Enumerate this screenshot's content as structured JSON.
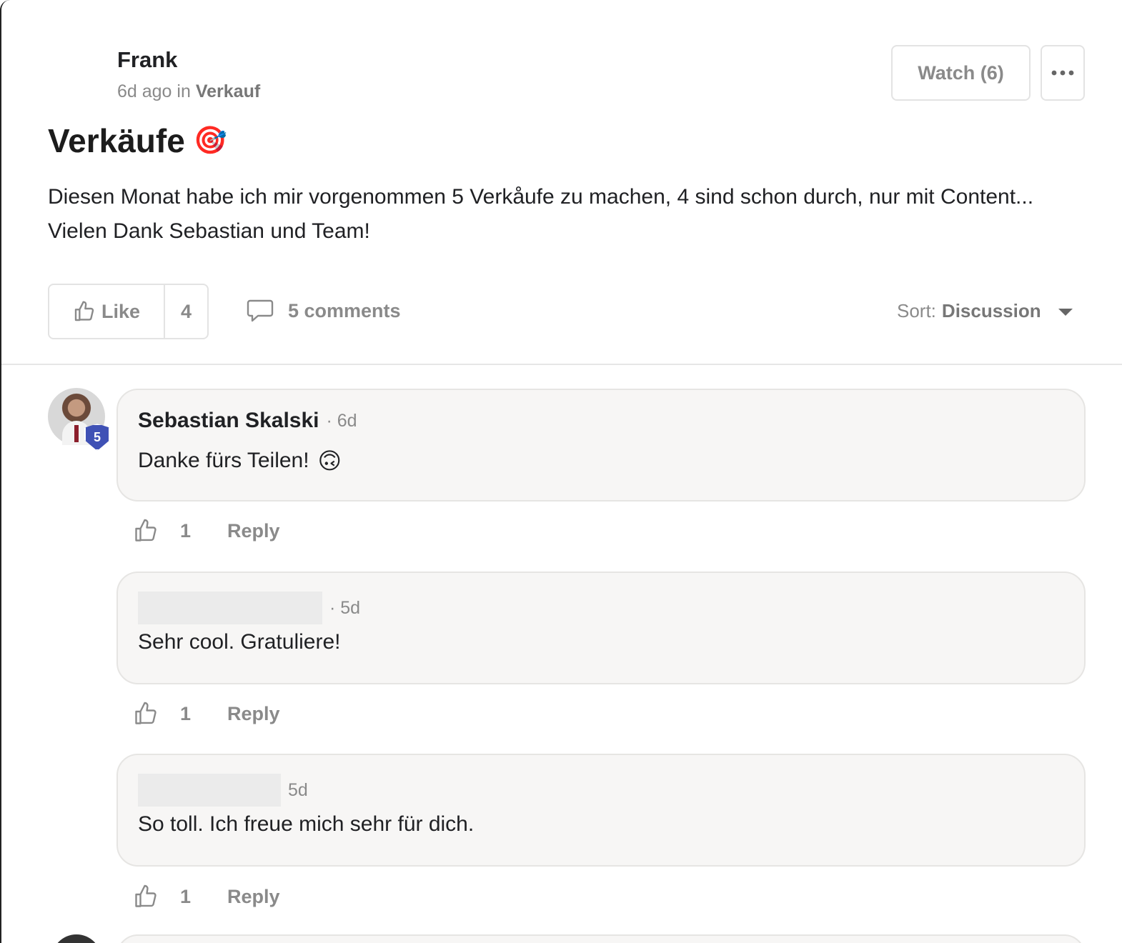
{
  "post": {
    "author": "Frank",
    "time": "6d ago",
    "in_label": "in",
    "category": "Verkauf",
    "title": "Verkäufe",
    "title_emoji": "🎯",
    "body": "Diesen Monat habe ich mir vorgenommen 5 Verkåufe zu machen, 4 sind schon durch, nur mit Content... Vielen Dank Sebastian und Team!",
    "watch_label": "Watch (6)",
    "like_label": "Like",
    "like_count": "4",
    "comments_label": "5 comments",
    "sort_label": "Sort:",
    "sort_value": "Discussion"
  },
  "comments": [
    {
      "name": "Sebastian Skalski",
      "time": "6d",
      "text": "Danke fürs Teilen!",
      "emoji": "🙃",
      "level": "5",
      "likes": "1",
      "reply_label": "Reply"
    },
    {
      "name": "",
      "time": "5d",
      "text": "Sehr cool. Gratuliere!",
      "likes": "1",
      "reply_label": "Reply"
    },
    {
      "name": "",
      "time": "5d",
      "text": "So toll. Ich freue mich sehr für dich.",
      "likes": "1",
      "reply_label": "Reply"
    }
  ],
  "icons": {
    "like": "thumbs-up-icon",
    "comment": "comment-bubble-icon",
    "more": "more-horizontal-icon",
    "sort": "caret-down-icon"
  }
}
